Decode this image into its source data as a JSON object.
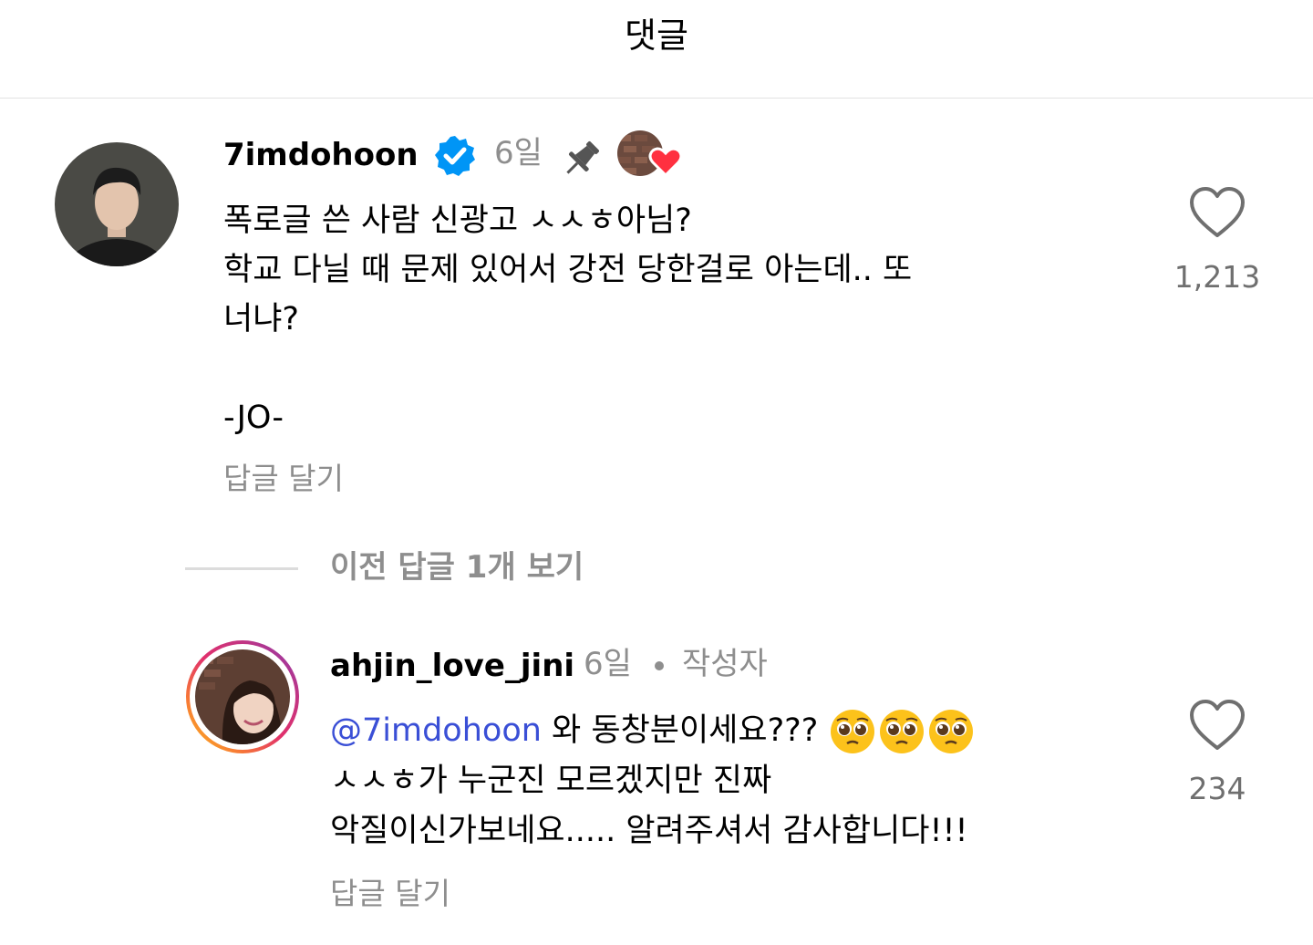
{
  "header": {
    "title": "댓글"
  },
  "comment1": {
    "username": "7imdohoon",
    "age": "6일",
    "lines": [
      "폭로글 쓴 사람 신광고 ㅅㅅㅎ아님?",
      "학교 다닐 때 문제 있어서 강전 당한걸로 아는데.. 또",
      "너냐?"
    ],
    "signature": "-JO-",
    "reply_label": "답글 달기",
    "like_count": "1,213"
  },
  "view_previous": {
    "label": "이전 답글 1개 보기"
  },
  "comment2": {
    "username": "ahjin_love_jini",
    "age": "6일",
    "author_tag": "작성자",
    "mention": "@7imdohoon",
    "line1_rest": " 와 동창분이세요??? ",
    "emojis": [
      "pleading-face",
      "pleading-face",
      "pleading-face"
    ],
    "line2": "ㅅㅅㅎ가 누군진 모르겠지만 진짜",
    "line3": "악질이신가보네요..... 알려주셔서 감사합니다!!!",
    "reply_label": "답글 달기",
    "like_count": "234"
  },
  "colors": {
    "verified": "#0095f6",
    "mention": "#3a4fd6",
    "heart_badge": "#ff3040",
    "muted": "#8e8e8e"
  }
}
